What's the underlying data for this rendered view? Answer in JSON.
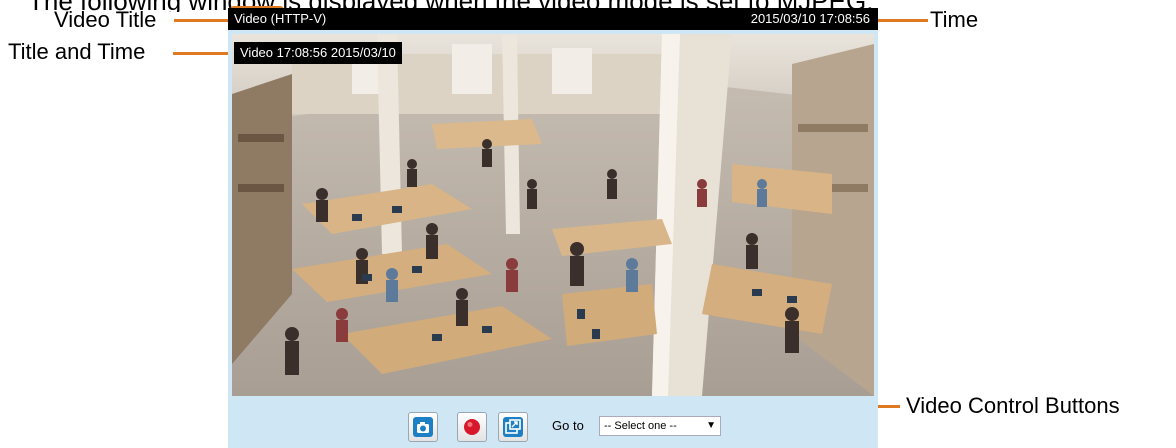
{
  "heading": "The following window is displayed when the video mode is set to MJPEG:",
  "callouts": {
    "video_title": "Video Title",
    "title_and_time": "Title and Time",
    "time": "Time",
    "video_control_buttons": "Video Control Buttons"
  },
  "viewer": {
    "title": "Video (HTTP-V)",
    "datetime": "2015/03/10  17:08:56",
    "overlay": "Video 17:08:56  2015/03/10",
    "goto_label": "Go to",
    "goto_select": "-- Select one --"
  },
  "colors": {
    "callout_line": "#e07a22",
    "panel_bg": "#cfe6f4",
    "snapshot_button": "#1d7fc4",
    "record_button": "#d6182a"
  },
  "icons": [
    "camera-icon",
    "record-icon",
    "pip-icon",
    "dropdown-arrow-icon"
  ]
}
